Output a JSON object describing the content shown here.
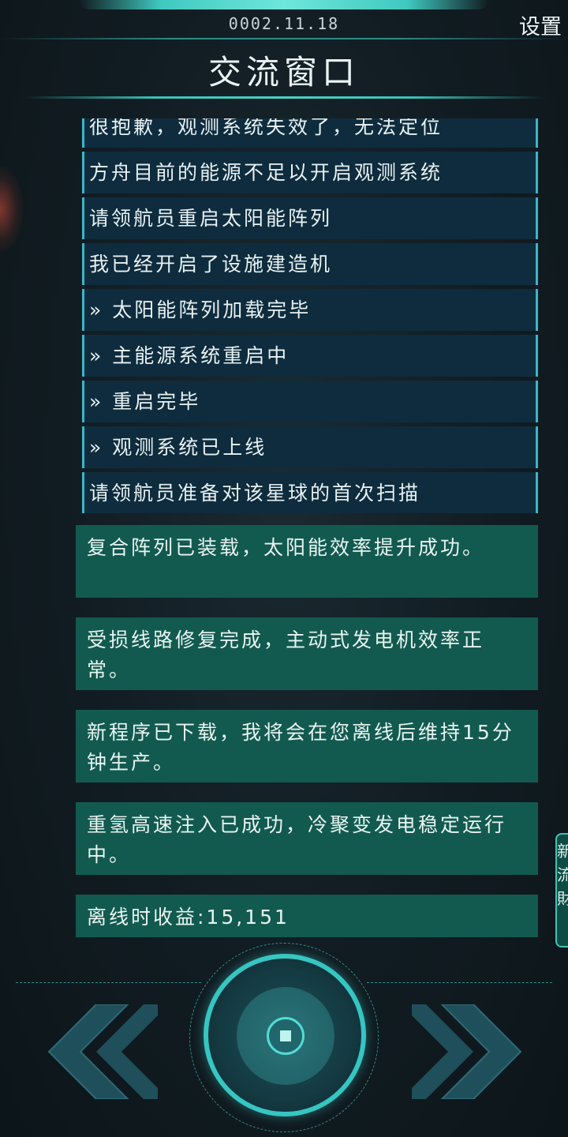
{
  "header": {
    "date": "0002.11.18",
    "settings_label": "设置",
    "title": "交流窗口"
  },
  "log": {
    "rows": [
      "很抱歉，观测系统失效了，无法定位",
      "方舟目前的能源不足以开启观测系统",
      "请领航员重启太阳能阵列",
      "我已经开启了设施建造机",
      "» 太阳能阵列加载完毕",
      "» 主能源系统重启中",
      "» 重启完毕",
      "» 观测系统已上线",
      "请领航员准备对该星球的首次扫描"
    ]
  },
  "messages": [
    "复合阵列已装载，太阳能效率提升成功。",
    "受损线路修复完成，主动式发电机效率正常。",
    "新程序已下载，我将会在您离线后维持15分钟生产。",
    "重氢高速注入已成功，冷聚变发电稳定运行中。",
    "离线时收益:15,151"
  ],
  "side_tab": {
    "text": "新流財"
  },
  "controls": {
    "prev_icon": "double-chevron-left-icon",
    "next_icon": "double-chevron-right-icon",
    "center_icon": "center-button-icon"
  },
  "colors": {
    "accent": "#36c6c2",
    "log_row_bg": "#0e2c3d",
    "message_bg": "#125a50"
  }
}
